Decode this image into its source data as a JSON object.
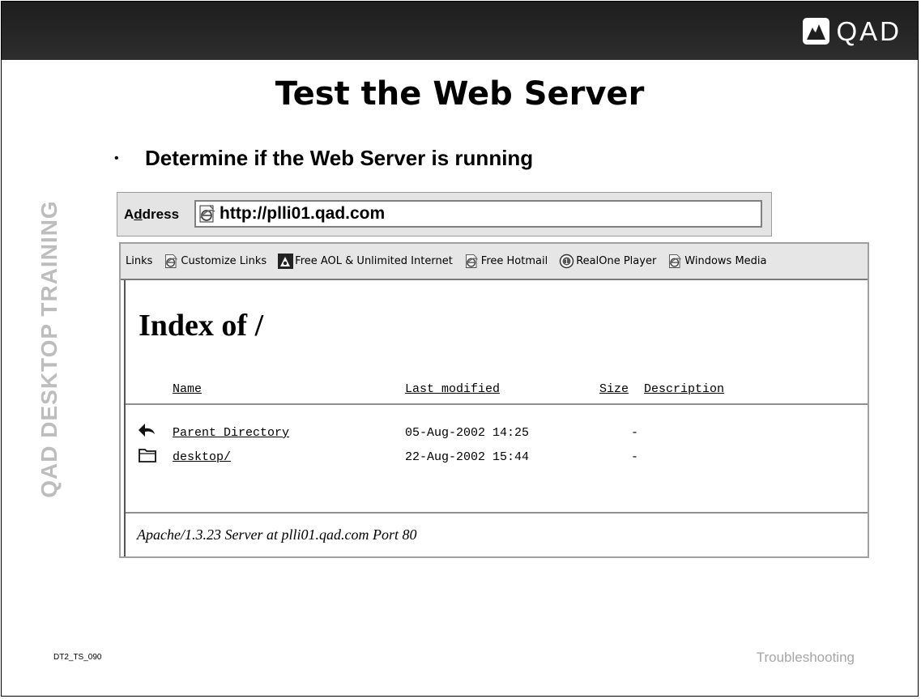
{
  "brand": {
    "logo_text": "QAD",
    "logo_icon": "qad-mountain-logo-icon"
  },
  "slide": {
    "title": "Test the Web Server",
    "bullet": "Determine if the Web Server is running",
    "side_label": "QAD DESKTOP TRAINING",
    "slide_id": "DT2_TS_090",
    "section": "Troubleshooting"
  },
  "browser": {
    "address": {
      "label_pre": "A",
      "label_accel": "d",
      "label_post": "dress",
      "url": "http://plli01.qad.com",
      "icon": "ie-page-icon"
    },
    "links": {
      "label": "Links",
      "items": [
        {
          "label": "Customize Links",
          "icon": "ie-page-icon"
        },
        {
          "label": "Free AOL & Unlimited Internet",
          "icon": "aol-icon"
        },
        {
          "label": "Free Hotmail",
          "icon": "ie-page-icon"
        },
        {
          "label": "RealOne Player",
          "icon": "realone-icon"
        },
        {
          "label": "Windows Media",
          "icon": "ie-page-icon"
        }
      ]
    },
    "page": {
      "heading": "Index of /",
      "columns": [
        "Name",
        "Last modified",
        "Size",
        "Description"
      ],
      "rows": [
        {
          "name": "Parent Directory",
          "modified": "05-Aug-2002 14:25",
          "size": "-",
          "icon": "back-arrow-icon"
        },
        {
          "name": "desktop/",
          "modified": "22-Aug-2002 15:44",
          "size": "-",
          "icon": "folder-icon"
        }
      ],
      "footer": "Apache/1.3.23 Server at plli01.qad.com Port 80"
    }
  }
}
